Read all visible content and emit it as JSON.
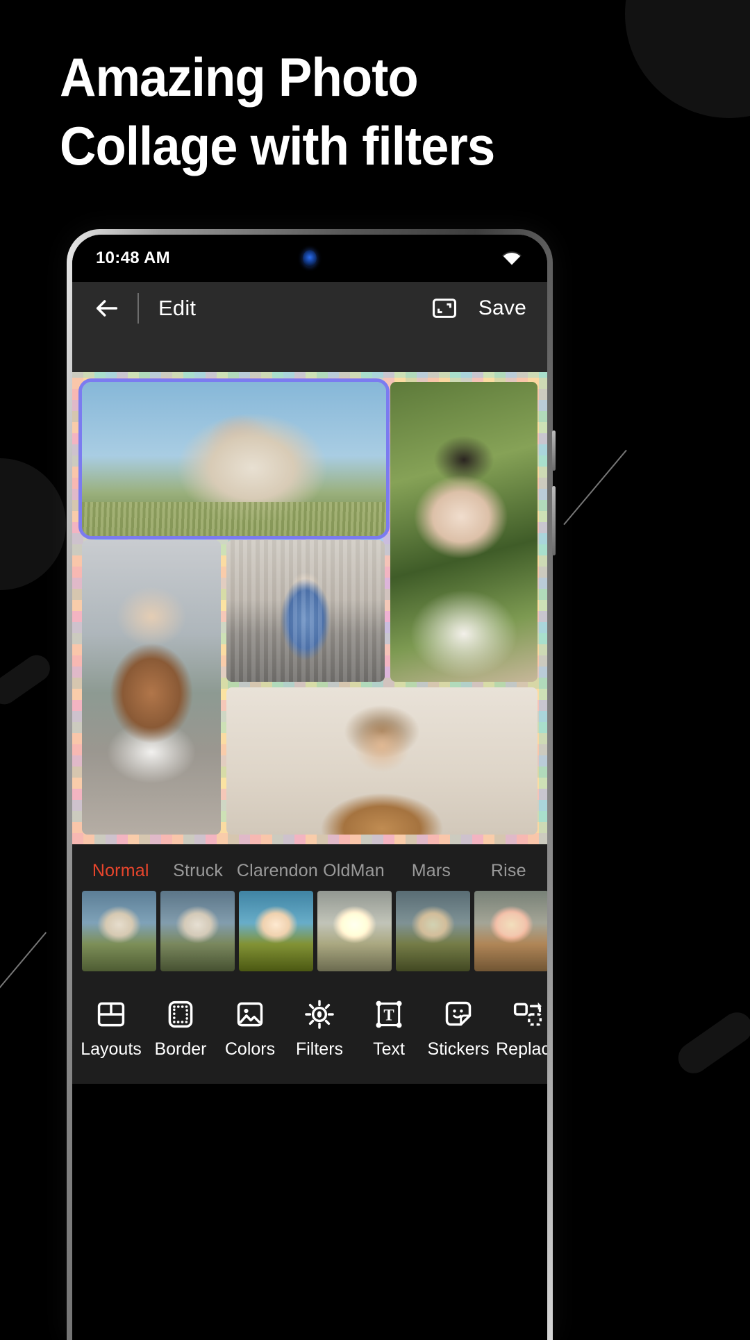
{
  "headline": {
    "line1": "Amazing Photo",
    "line2": "Collage with filters"
  },
  "phone": {
    "status_bar": {
      "time": "10:48 AM",
      "wifi_icon": "wifi-icon",
      "camera": "punch-hole-camera"
    },
    "app_bar": {
      "back_icon": "back-arrow-icon",
      "title": "Edit",
      "ratio_icon": "aspect-ratio-icon",
      "save_label": "Save"
    },
    "collage": {
      "border_style": "pastel-checker",
      "selected_cell": "photo-1",
      "cells": [
        {
          "id": "photo-1",
          "alt": "woman in beige jacket against blue sky"
        },
        {
          "id": "photo-2",
          "alt": "woman in jungle with dappled light"
        },
        {
          "id": "photo-3",
          "alt": "woman by lake in white skirt and boots"
        },
        {
          "id": "photo-4",
          "alt": "woman in blue coat in front of cathedral"
        },
        {
          "id": "photo-5",
          "alt": "man in tan blazer on beige wall"
        }
      ]
    },
    "filters": {
      "active": "Normal",
      "active_color": "#e8452c",
      "items": [
        {
          "label": "Normal",
          "thumb": "t-normal"
        },
        {
          "label": "Struck",
          "thumb": "t-struck"
        },
        {
          "label": "Clarendon",
          "thumb": "t-clarendon"
        },
        {
          "label": "OldMan",
          "thumb": "t-oldman"
        },
        {
          "label": "Mars",
          "thumb": "t-mars"
        },
        {
          "label": "Rise",
          "thumb": "t-rise"
        }
      ]
    },
    "toolbar": {
      "items": [
        {
          "label": "Layouts",
          "icon": "layout-grid-icon"
        },
        {
          "label": "Border",
          "icon": "dashed-border-icon"
        },
        {
          "label": "Colors",
          "icon": "image-icon"
        },
        {
          "label": "Filters",
          "icon": "brightness-icon"
        },
        {
          "label": "Text",
          "icon": "text-box-icon"
        },
        {
          "label": "Stickers",
          "icon": "sticker-face-icon"
        },
        {
          "label": "Replace",
          "icon": "replace-icon"
        }
      ]
    }
  }
}
